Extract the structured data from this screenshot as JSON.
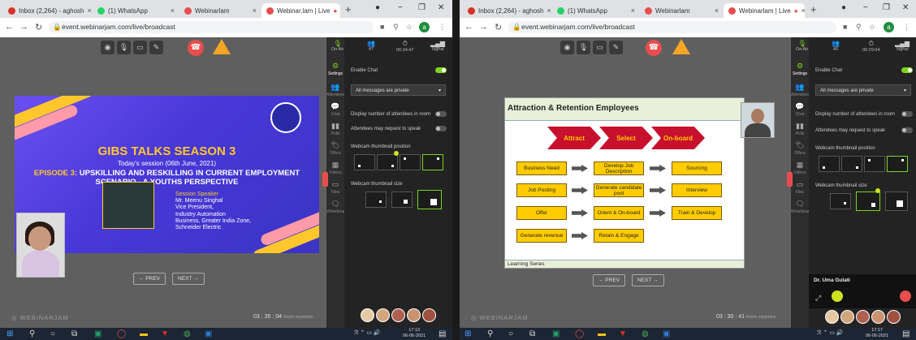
{
  "left": {
    "tabs": [
      {
        "label": "Inbox (2,264) - aghosh",
        "color": "#d93025"
      },
      {
        "label": "(1) WhatsApp",
        "color": "#25d366"
      },
      {
        "label": "Webinarlam",
        "color": "#e84d4d"
      },
      {
        "label": "Webinar.lam | Live",
        "color": "#e84d4d"
      }
    ],
    "url": "event.webinarjam.com/live/broadcast",
    "profile_initial": "a",
    "nav": {
      "prev": "← PREV",
      "next": "NEXT →"
    },
    "watermark": "WEBINARJAM",
    "timer": "03 : 35 : 04",
    "timer_label": "Room expiration",
    "status": {
      "mic": "On Air",
      "attendees": "47",
      "clock": "00:34:47",
      "signal": "Signal"
    },
    "slide": {
      "title": "GIBS TALKS SEASON 3",
      "session": "Today's session (06th June, 2021)",
      "episode_label": "EPISODE 3:",
      "episode_text": "UPSKILLING AND RESKILLING IN CURRENT EMPLOYMENT SCENARIO - A YOUTHS PERSPECTIVE",
      "speaker_label": "Session Speaker",
      "speaker_lines": [
        "Mr. Meenu Singhal",
        "Vice President,",
        "Industry Automation",
        "Business, Greater India Zone,",
        "Schneider Electric"
      ]
    }
  },
  "right": {
    "tabs": [
      {
        "label": "Inbox (2,264) - aghosh",
        "color": "#d93025"
      },
      {
        "label": "(1) WhatsApp",
        "color": "#25d366"
      },
      {
        "label": "Webinarlam",
        "color": "#e84d4d"
      },
      {
        "label": "Webinarlam | Live",
        "color": "#e84d4d"
      }
    ],
    "url": "event.webinarjam.com/live/broadcast",
    "profile_initial": "a",
    "nav": {
      "prev": "← PREV",
      "next": "NEXT →"
    },
    "watermark": "WEBINARJAM",
    "timer": "03 : 30 : 41",
    "timer_label": "Room expiration",
    "status": {
      "mic": "On Air",
      "attendees": "40",
      "clock": "00:29:04",
      "signal": "Signal"
    },
    "presenter_name": "Dr. Uma Gulati",
    "slide": {
      "title": "Attraction & Retention Employees",
      "chevrons": [
        "Attract",
        "Select",
        "On-board"
      ],
      "col1": [
        "Business Need",
        "Job Posting",
        "Offer",
        "Generate revenue"
      ],
      "col2": [
        "Develop Job Description",
        "Generate candidate pool",
        "Orient & On-board",
        "Retain & Engage"
      ],
      "col3": [
        "Sourcing",
        "Interview",
        "Train & Develop"
      ],
      "footer": "Learning Series"
    }
  },
  "settings": {
    "enable_chat": "Enable Chat",
    "messages_select": "All messages are private",
    "display_attendees": "Display number of attendees in room",
    "request_speak": "Attendees may request to speak",
    "thumb_position": "Webcam thumbnail position",
    "thumb_size": "Webcam thumbnail size"
  },
  "rail": [
    "Settings",
    "Attendees",
    "Chat",
    "Polls",
    "Offers",
    "Videos",
    "Files",
    "Whiteboard"
  ],
  "taskbar": {
    "left_time": "17:13",
    "left_date": "06-06-2021",
    "right_time": "17:17",
    "right_date": "06-06-2021"
  },
  "colors": {
    "accent_green": "#7fd320",
    "brand_red": "#e84d4d",
    "slide_purple": "#4838d8",
    "chevron_red": "#c8102e",
    "box_yellow": "#ffcc00"
  }
}
